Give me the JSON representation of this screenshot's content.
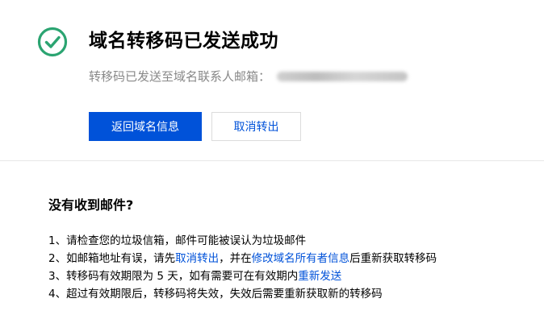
{
  "header": {
    "title": "域名转移码已发送成功",
    "subtitle_prefix": "转移码已发送至域名联系人邮箱：",
    "email_masked": "3********"
  },
  "actions": {
    "primary_label": "返回域名信息",
    "secondary_label": "取消转出"
  },
  "help": {
    "title": "没有收到邮件?",
    "items": [
      {
        "text": "1、请检查您的垃圾信箱，邮件可能被误认为垃圾邮件"
      },
      {
        "t1": "2、如邮箱地址有误，请先",
        "link1": "取消转出",
        "t2": "，并在",
        "link2": "修改域名所有者信息",
        "t3": "后重新获取转移码"
      },
      {
        "t1": "3、转移码有效期限为 5 天，如有需要可在有效期内",
        "link1": "重新发送"
      },
      {
        "text": "4、超过有效期限后，转移码将失效，失效后需要重新获取新的转移码"
      }
    ]
  },
  "colors": {
    "success": "#2ba471",
    "primary": "#0052d9",
    "muted_text": "#888888",
    "divider": "#e7e7e7"
  },
  "icons": {
    "success": "check-circle-icon"
  }
}
